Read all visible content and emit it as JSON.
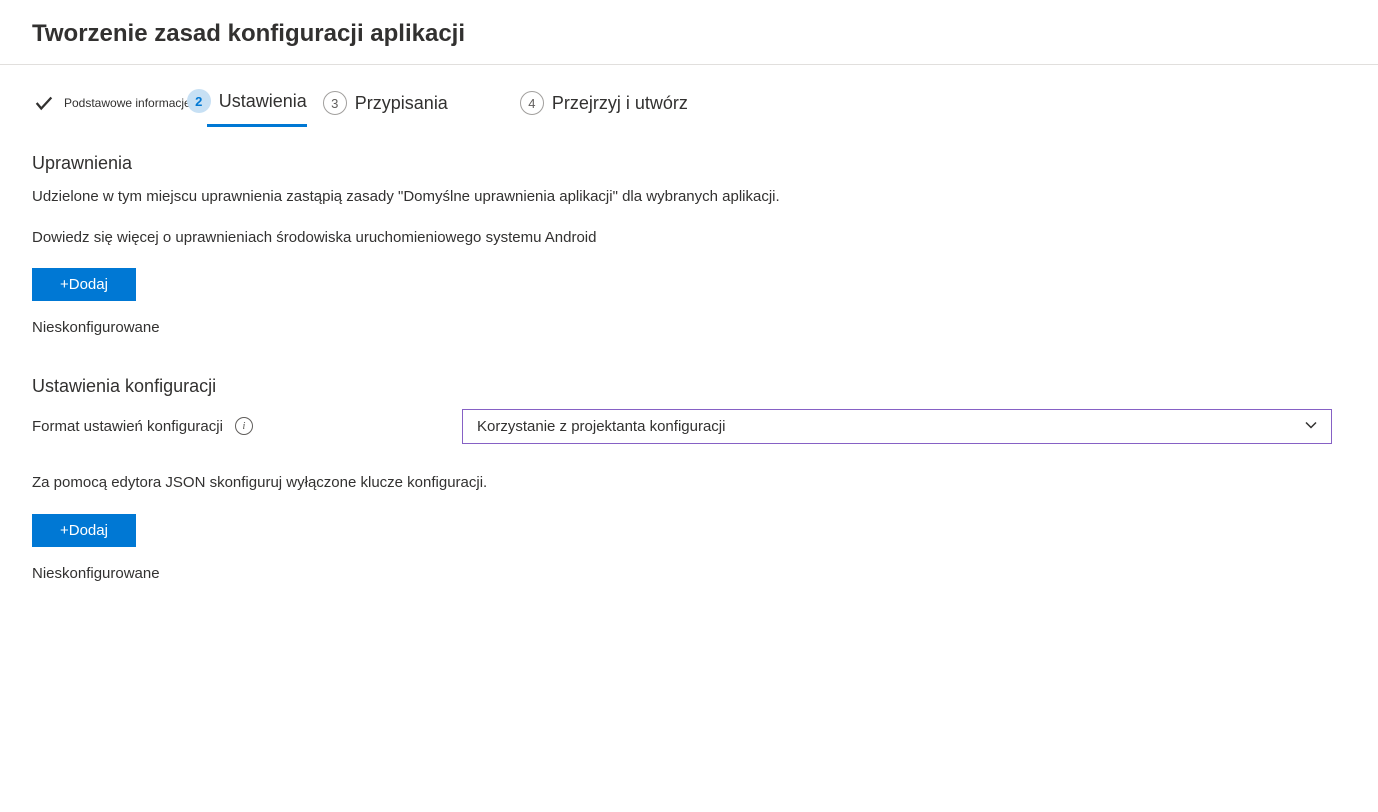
{
  "header": {
    "title": "Tworzenie zasad konfiguracji aplikacji"
  },
  "stepper": {
    "step1": {
      "label": "Podstawowe informacje"
    },
    "step2": {
      "number": "2",
      "label": "Ustawienia"
    },
    "step3": {
      "number": "3",
      "label": "Przypisania"
    },
    "step4": {
      "number": "4",
      "label": "Przejrzyj i utwórz"
    }
  },
  "permissions": {
    "heading": "Uprawnienia",
    "description": "Udzielone w tym miejscu uprawnienia zastąpią zasady \"Domyślne uprawnienia aplikacji\" dla wybranych aplikacji.",
    "learn_more": "Dowiedz się więcej o uprawnieniach środowiska uruchomieniowego systemu Android",
    "add_button": "+Dodaj",
    "status": "Nieskonfigurowane"
  },
  "config": {
    "heading": "Ustawienia konfiguracji",
    "format_label": "Format ustawień konfiguracji",
    "format_value": "Korzystanie z projektanta konfiguracji",
    "json_hint": "Za pomocą edytora JSON skonfiguruj wyłączone klucze konfiguracji.",
    "add_button": "+Dodaj",
    "status": "Nieskonfigurowane"
  }
}
